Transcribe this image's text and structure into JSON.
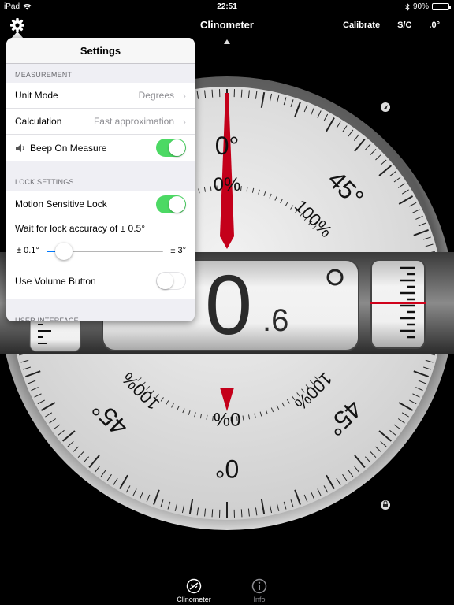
{
  "status": {
    "device": "iPad",
    "time": "22:51",
    "battery_text": "90%",
    "battery_level": 0.9
  },
  "nav": {
    "title": "Clinometer",
    "calibrate": "Calibrate",
    "sc": "S/C",
    "degree_mode": ".0°"
  },
  "dial": {
    "labels": {
      "top_deg": "0°",
      "top_pct": "0%",
      "upper_right_deg": "45°",
      "upper_right_pct": "100%",
      "bottom_deg": "0°",
      "bottom_pct": "0%",
      "lower_left_deg": "45°",
      "lower_left_pct": "100%",
      "lower_right_deg": "45°",
      "lower_right_pct": "100%"
    },
    "reading_main": "0",
    "reading_decimal": ".6",
    "reading_value": 0.6
  },
  "settings": {
    "title": "Settings",
    "measurement_header": "MEASUREMENT",
    "unit_mode_label": "Unit Mode",
    "unit_mode_value": "Degrees",
    "calculation_label": "Calculation",
    "calculation_value": "Fast approximation",
    "beep_label": "Beep On Measure",
    "beep_on": true,
    "lock_header": "LOCK SETTINGS",
    "motion_lock_label": "Motion Sensitive Lock",
    "motion_lock_on": true,
    "wait_label": "Wait for lock accuracy of ± 0.5°",
    "slider_min": "± 0.1°",
    "slider_max": "± 3°",
    "slider_fraction": 0.14,
    "volume_label": "Use Volume Button",
    "volume_on": false,
    "ui_header": "USER INTERFACE"
  },
  "tabs": [
    {
      "label": "Clinometer",
      "icon": "clinometer-icon",
      "active": true
    },
    {
      "label": "Info",
      "icon": "info-icon",
      "active": false
    }
  ],
  "colors": {
    "accent_green": "#4cd964",
    "needle_red": "#d0021b",
    "dial_face": "#e6e6e6"
  }
}
